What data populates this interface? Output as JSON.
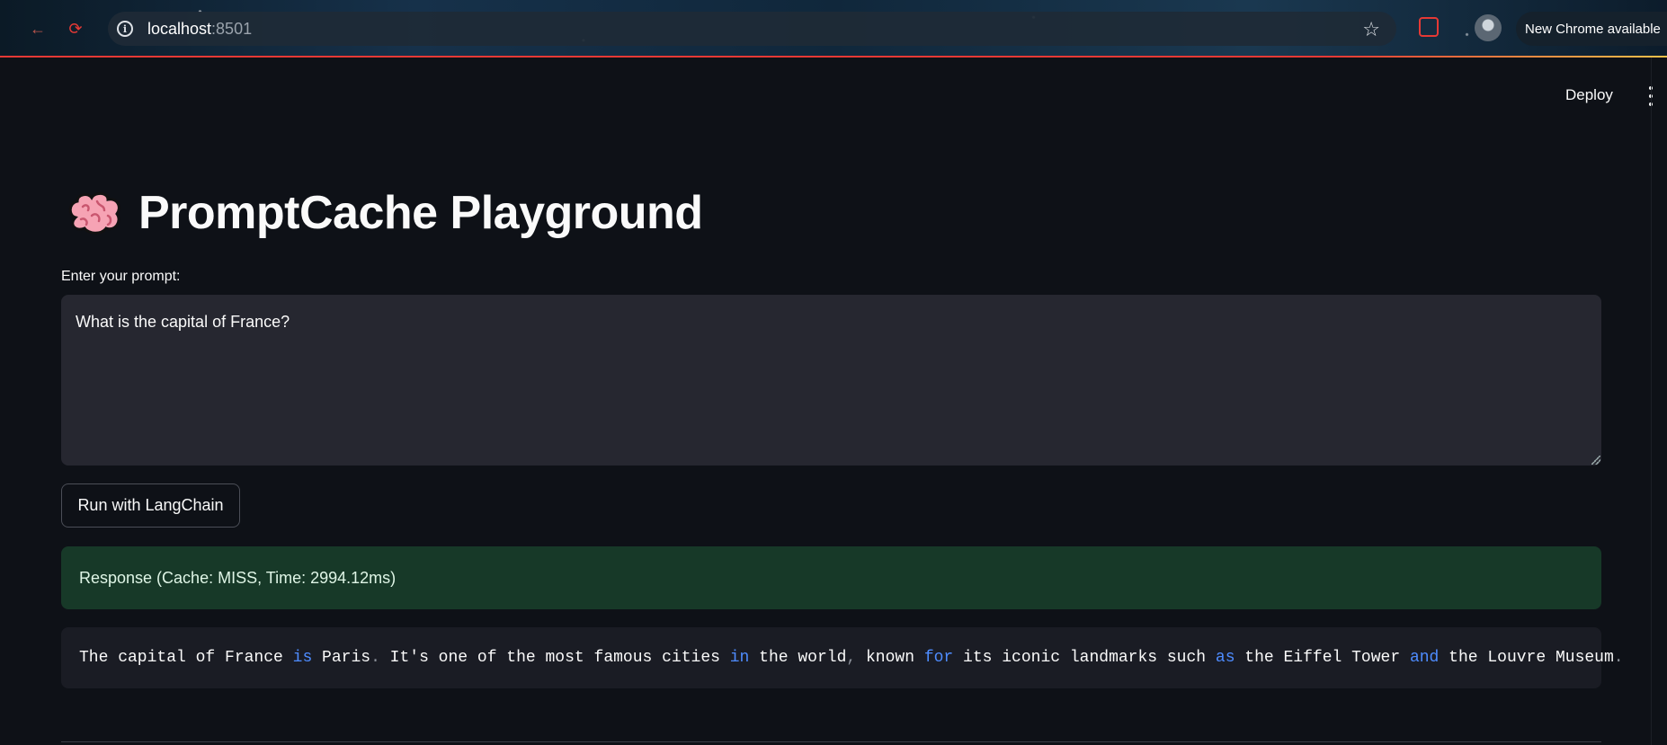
{
  "browser": {
    "url_host": "localhost",
    "url_port": ":8501",
    "update_label": "New Chrome available"
  },
  "header": {
    "deploy_label": "Deploy"
  },
  "main": {
    "title": "PromptCache Playground",
    "prompt_label": "Enter your prompt:",
    "prompt_value": "What is the capital of France?",
    "run_button_label": "Run with LangChain",
    "status_text": "Response (Cache: MISS, Time: 2994.12ms)",
    "response_tokens": [
      {
        "t": "The capital of France ",
        "k": "txt"
      },
      {
        "t": "is",
        "k": "kw"
      },
      {
        "t": " Paris",
        "k": "txt"
      },
      {
        "t": ".",
        "k": "pn"
      },
      {
        "t": " It's one of the most famous cities ",
        "k": "txt"
      },
      {
        "t": "in",
        "k": "kw"
      },
      {
        "t": " the world",
        "k": "txt"
      },
      {
        "t": ",",
        "k": "pn"
      },
      {
        "t": " known ",
        "k": "txt"
      },
      {
        "t": "for",
        "k": "kw"
      },
      {
        "t": " its iconic landmarks such ",
        "k": "txt"
      },
      {
        "t": "as",
        "k": "kw"
      },
      {
        "t": " the Eiffel Tower ",
        "k": "txt"
      },
      {
        "t": "and",
        "k": "kw"
      },
      {
        "t": " the Louvre Museum",
        "k": "txt"
      },
      {
        "t": ".",
        "k": "pn"
      }
    ]
  },
  "colors": {
    "background": "#0e1117",
    "success_bg": "#173928",
    "keyword": "#4e8cff"
  }
}
